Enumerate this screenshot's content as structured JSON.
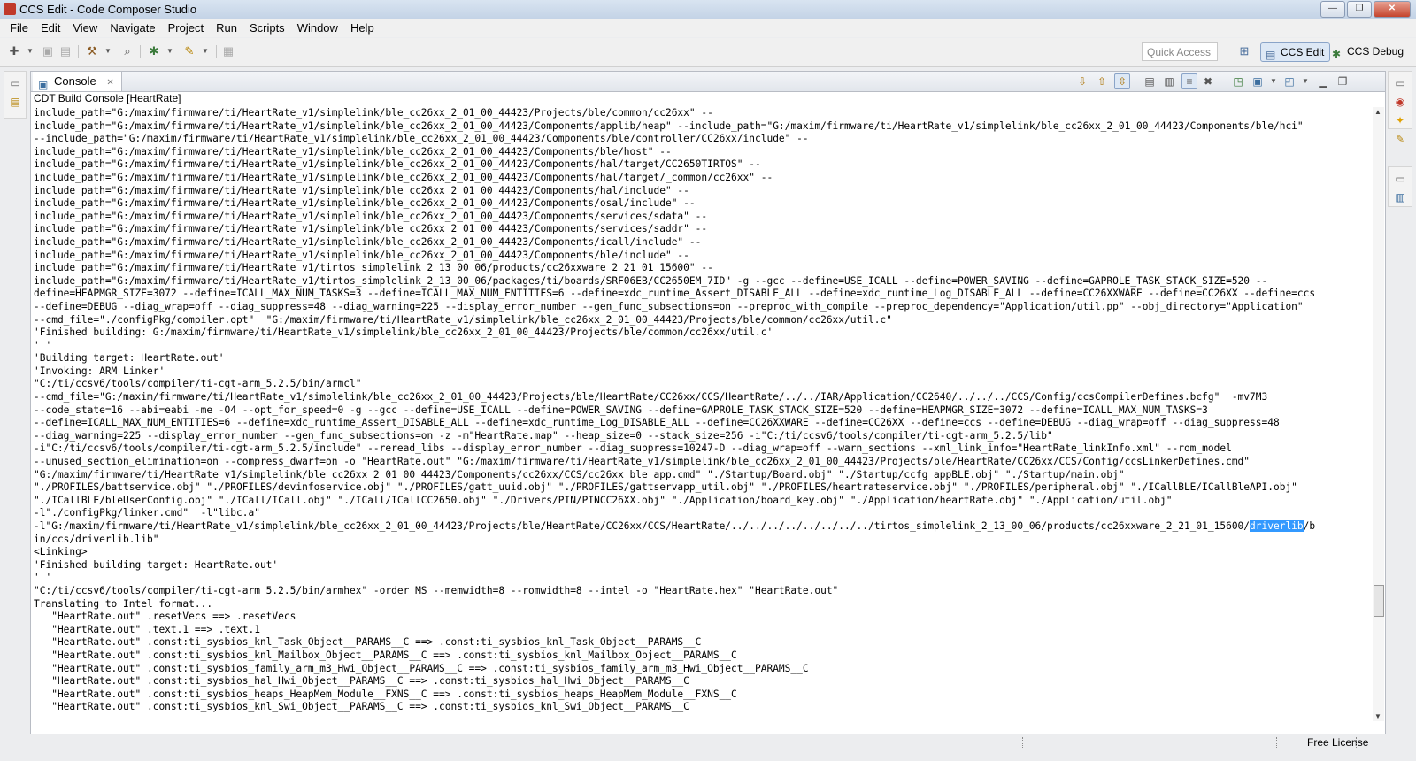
{
  "window": {
    "title": "CCS Edit - Code Composer Studio",
    "min": "—",
    "max": "❐",
    "close": "✕"
  },
  "menu": [
    "File",
    "Edit",
    "View",
    "Navigate",
    "Project",
    "Run",
    "Scripts",
    "Window",
    "Help"
  ],
  "toolbar": {
    "quick_access_placeholder": "Quick Access",
    "perspectives": [
      {
        "label": "CCS Edit",
        "active": true
      },
      {
        "label": "CCS Debug",
        "active": false
      }
    ]
  },
  "view": {
    "tab_label": "Console",
    "console_title": "CDT Build Console [HeartRate]",
    "lines": [
      "include_path=\"G:/maxim/firmware/ti/HeartRate_v1/simplelink/ble_cc26xx_2_01_00_44423/Projects/ble/common/cc26xx\" --",
      "include_path=\"G:/maxim/firmware/ti/HeartRate_v1/simplelink/ble_cc26xx_2_01_00_44423/Components/applib/heap\" --include_path=\"G:/maxim/firmware/ti/HeartRate_v1/simplelink/ble_cc26xx_2_01_00_44423/Components/ble/hci\"",
      "--include_path=\"G:/maxim/firmware/ti/HeartRate_v1/simplelink/ble_cc26xx_2_01_00_44423/Components/ble/controller/CC26xx/include\" --",
      "include_path=\"G:/maxim/firmware/ti/HeartRate_v1/simplelink/ble_cc26xx_2_01_00_44423/Components/ble/host\" --",
      "include_path=\"G:/maxim/firmware/ti/HeartRate_v1/simplelink/ble_cc26xx_2_01_00_44423/Components/hal/target/CC2650TIRTOS\" --",
      "include_path=\"G:/maxim/firmware/ti/HeartRate_v1/simplelink/ble_cc26xx_2_01_00_44423/Components/hal/target/_common/cc26xx\" --",
      "include_path=\"G:/maxim/firmware/ti/HeartRate_v1/simplelink/ble_cc26xx_2_01_00_44423/Components/hal/include\" --",
      "include_path=\"G:/maxim/firmware/ti/HeartRate_v1/simplelink/ble_cc26xx_2_01_00_44423/Components/osal/include\" --",
      "include_path=\"G:/maxim/firmware/ti/HeartRate_v1/simplelink/ble_cc26xx_2_01_00_44423/Components/services/sdata\" --",
      "include_path=\"G:/maxim/firmware/ti/HeartRate_v1/simplelink/ble_cc26xx_2_01_00_44423/Components/services/saddr\" --",
      "include_path=\"G:/maxim/firmware/ti/HeartRate_v1/simplelink/ble_cc26xx_2_01_00_44423/Components/icall/include\" --",
      "include_path=\"G:/maxim/firmware/ti/HeartRate_v1/simplelink/ble_cc26xx_2_01_00_44423/Components/ble/include\" --",
      "include_path=\"G:/maxim/firmware/ti/HeartRate_v1/tirtos_simplelink_2_13_00_06/products/cc26xxware_2_21_01_15600\" --",
      "include_path=\"G:/maxim/firmware/ti/HeartRate_v1/tirtos_simplelink_2_13_00_06/packages/ti/boards/SRF06EB/CC2650EM_7ID\" -g --gcc --define=USE_ICALL --define=POWER_SAVING --define=GAPROLE_TASK_STACK_SIZE=520 --",
      "define=HEAPMGR_SIZE=3072 --define=ICALL_MAX_NUM_TASKS=3 --define=ICALL_MAX_NUM_ENTITIES=6 --define=xdc_runtime_Assert_DISABLE_ALL --define=xdc_runtime_Log_DISABLE_ALL --define=CC26XXWARE --define=CC26XX --define=ccs",
      "--define=DEBUG --diag_wrap=off --diag_suppress=48 --diag_warning=225 --display_error_number --gen_func_subsections=on --preproc_with_compile --preproc_dependency=\"Application/util.pp\" --obj_directory=\"Application\"",
      "--cmd_file=\"./configPkg/compiler.opt\"  \"G:/maxim/firmware/ti/HeartRate_v1/simplelink/ble_cc26xx_2_01_00_44423/Projects/ble/common/cc26xx/util.c\"",
      "'Finished building: G:/maxim/firmware/ti/HeartRate_v1/simplelink/ble_cc26xx_2_01_00_44423/Projects/ble/common/cc26xx/util.c'",
      "' '",
      "'Building target: HeartRate.out'",
      "'Invoking: ARM Linker'",
      "\"C:/ti/ccsv6/tools/compiler/ti-cgt-arm_5.2.5/bin/armcl\"",
      "--cmd_file=\"G:/maxim/firmware/ti/HeartRate_v1/simplelink/ble_cc26xx_2_01_00_44423/Projects/ble/HeartRate/CC26xx/CCS/HeartRate/../../IAR/Application/CC2640/../../../CCS/Config/ccsCompilerDefines.bcfg\"  -mv7M3",
      "--code_state=16 --abi=eabi -me -O4 --opt_for_speed=0 -g --gcc --define=USE_ICALL --define=POWER_SAVING --define=GAPROLE_TASK_STACK_SIZE=520 --define=HEAPMGR_SIZE=3072 --define=ICALL_MAX_NUM_TASKS=3",
      "--define=ICALL_MAX_NUM_ENTITIES=6 --define=xdc_runtime_Assert_DISABLE_ALL --define=xdc_runtime_Log_DISABLE_ALL --define=CC26XXWARE --define=CC26XX --define=ccs --define=DEBUG --diag_wrap=off --diag_suppress=48",
      "--diag_warning=225 --display_error_number --gen_func_subsections=on -z -m\"HeartRate.map\" --heap_size=0 --stack_size=256 -i\"C:/ti/ccsv6/tools/compiler/ti-cgt-arm_5.2.5/lib\"",
      "-i\"C:/ti/ccsv6/tools/compiler/ti-cgt-arm_5.2.5/include\" --reread_libs --display_error_number --diag_suppress=10247-D --diag_wrap=off --warn_sections --xml_link_info=\"HeartRate_linkInfo.xml\" --rom_model",
      "--unused_section_elimination=on --compress_dwarf=on -o \"HeartRate.out\" \"G:/maxim/firmware/ti/HeartRate_v1/simplelink/ble_cc26xx_2_01_00_44423/Projects/ble/HeartRate/CC26xx/CCS/Config/ccsLinkerDefines.cmd\"",
      "\"G:/maxim/firmware/ti/HeartRate_v1/simplelink/ble_cc26xx_2_01_00_44423/Components/cc26xx/CCS/cc26xx_ble_app.cmd\" \"./Startup/Board.obj\" \"./Startup/ccfg_appBLE.obj\" \"./Startup/main.obj\"",
      "\"./PROFILES/battservice.obj\" \"./PROFILES/devinfoservice.obj\" \"./PROFILES/gatt_uuid.obj\" \"./PROFILES/gattservapp_util.obj\" \"./PROFILES/heartrateservice.obj\" \"./PROFILES/peripheral.obj\" \"./ICallBLE/ICallBleAPI.obj\"",
      "\"./ICallBLE/bleUserConfig.obj\" \"./ICall/ICall.obj\" \"./ICall/ICallCC2650.obj\" \"./Drivers/PIN/PINCC26XX.obj\" \"./Application/board_key.obj\" \"./Application/heartRate.obj\" \"./Application/util.obj\"",
      "-l\"./configPkg/linker.cmd\"  -l\"libc.a\"",
      "__SEL_LINE__",
      "in/ccs/driverlib.lib\"",
      "<Linking>",
      "'Finished building target: HeartRate.out'",
      "' '",
      "\"C:/ti/ccsv6/tools/compiler/ti-cgt-arm_5.2.5/bin/armhex\" -order MS --memwidth=8 --romwidth=8 --intel -o \"HeartRate.hex\" \"HeartRate.out\"",
      "Translating to Intel format...",
      "   \"HeartRate.out\" .resetVecs ==> .resetVecs",
      "   \"HeartRate.out\" .text.1 ==> .text.1",
      "   \"HeartRate.out\" .const:ti_sysbios_knl_Task_Object__PARAMS__C ==> .const:ti_sysbios_knl_Task_Object__PARAMS__C",
      "   \"HeartRate.out\" .const:ti_sysbios_knl_Mailbox_Object__PARAMS__C ==> .const:ti_sysbios_knl_Mailbox_Object__PARAMS__C",
      "   \"HeartRate.out\" .const:ti_sysbios_family_arm_m3_Hwi_Object__PARAMS__C ==> .const:ti_sysbios_family_arm_m3_Hwi_Object__PARAMS__C",
      "   \"HeartRate.out\" .const:ti_sysbios_hal_Hwi_Object__PARAMS__C ==> .const:ti_sysbios_hal_Hwi_Object__PARAMS__C",
      "   \"HeartRate.out\" .const:ti_sysbios_heaps_HeapMem_Module__FXNS__C ==> .const:ti_sysbios_heaps_HeapMem_Module__FXNS__C",
      "   \"HeartRate.out\" .const:ti_sysbios_knl_Swi_Object__PARAMS__C ==> .const:ti_sysbios_knl_Swi_Object__PARAMS__C"
    ],
    "selected_line": {
      "before": "-l\"G:/maxim/firmware/ti/HeartRate_v1/simplelink/ble_cc26xx_2_01_00_44423/Projects/ble/HeartRate/CC26xx/CCS/HeartRate/../../../../../../../../tirtos_simplelink_2_13_00_06/products/cc26xxware_2_21_01_15600/",
      "selected": "driverlib",
      "after": "/b"
    }
  },
  "status": {
    "license": "Free License"
  }
}
